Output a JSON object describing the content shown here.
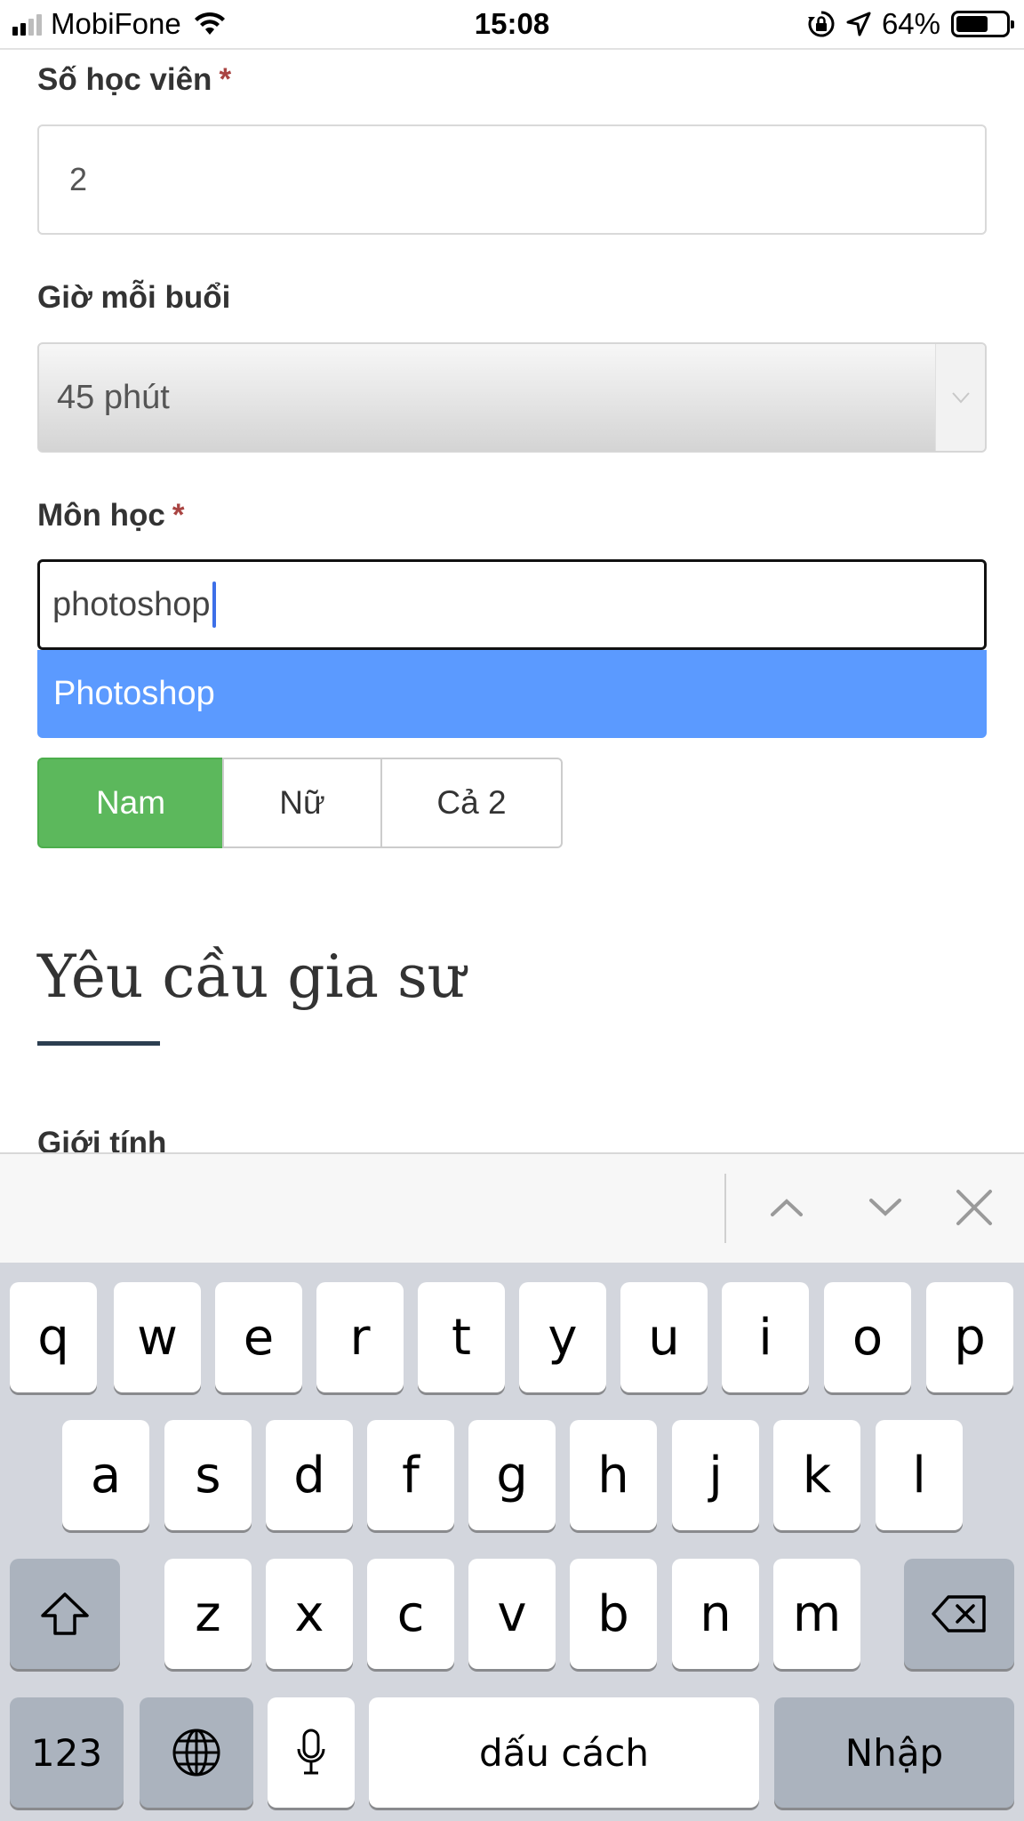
{
  "status_bar": {
    "carrier": "MobiFone",
    "time": "15:08",
    "battery_percent": "64%",
    "battery_level": 0.64
  },
  "form": {
    "students_label": "Số học viên",
    "students_required_mark": "*",
    "students_value": "2",
    "hours_label": "Giờ mỗi buổi",
    "hours_selected": "45 phút",
    "subject_label": "Môn học",
    "subject_required_mark": "*",
    "subject_input_value": "photoshop",
    "subject_suggestion": "Photoshop",
    "gender_options": [
      "Nam",
      "Nữ",
      "Cả 2"
    ],
    "gender_selected": "Nam"
  },
  "section": {
    "title": "Yêu cầu gia sư",
    "next_label": "Giới tính"
  },
  "colors": {
    "suggestion_highlight": "#5b9aff",
    "selected_toggle": "#5cb85c",
    "required_mark": "#a94442",
    "caret": "#3d6fe8"
  },
  "accessory_bar": {
    "icons": [
      "chevron-up-icon",
      "chevron-down-icon",
      "close-icon"
    ]
  },
  "keyboard": {
    "row1": [
      "q",
      "w",
      "e",
      "r",
      "t",
      "y",
      "u",
      "i",
      "o",
      "p"
    ],
    "row2": [
      "a",
      "s",
      "d",
      "f",
      "g",
      "h",
      "j",
      "k",
      "l"
    ],
    "row3": [
      "z",
      "x",
      "c",
      "v",
      "b",
      "n",
      "m"
    ],
    "numbers_key": "123",
    "space_key": "dấu cách",
    "return_key": "Nhập",
    "icons": [
      "shift-icon",
      "backspace-icon",
      "globe-icon",
      "microphone-icon"
    ]
  }
}
